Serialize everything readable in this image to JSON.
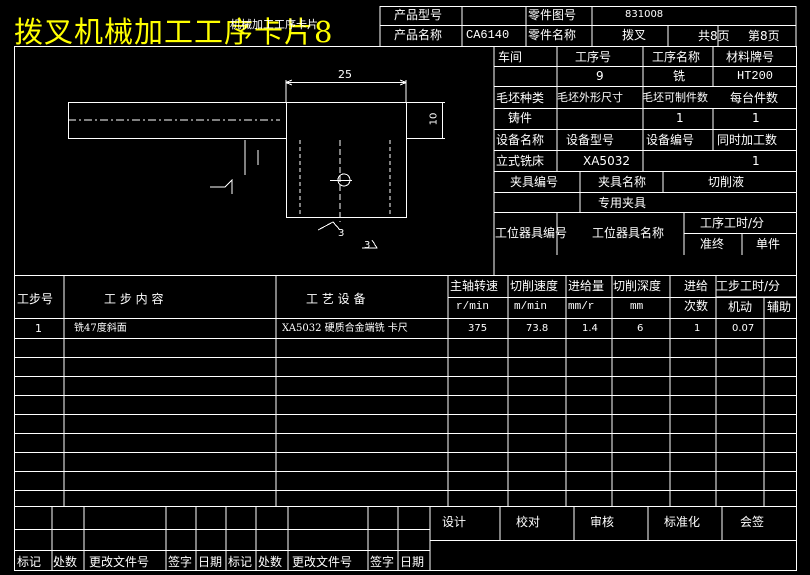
{
  "title": "拨叉机械加工工序卡片8",
  "header": {
    "card_name": "机械加工工序卡片",
    "product_model_label": "产品型号",
    "part_drawing_label": "零件图号",
    "part_drawing_no": "831008",
    "product_name_label": "产品名称",
    "product_name": "CA6140",
    "part_name_label": "零件名称",
    "part_name": "拨叉",
    "total_pages": "共8页",
    "page_no": "第8页"
  },
  "process_info": {
    "workshop_label": "车间",
    "op_no_label": "工序号",
    "op_name_label": "工序名称",
    "material_label": "材料牌号",
    "op_no": "9",
    "op_name": "铣",
    "material": "HT200",
    "blank_type_label": "毛坯种类",
    "blank_size_label": "毛坯外形尺寸",
    "blank_count_label": "毛坯可制件数",
    "per_unit_label": "每台件数",
    "blank_type": "铸件",
    "blank_count": "1",
    "per_unit": "1",
    "equip_name_label": "设备名称",
    "equip_model_label": "设备型号",
    "equip_no_label": "设备编号",
    "simul_label": "同时加工数",
    "equip_name": "立式铣床",
    "equip_model": "XA5032",
    "simul": "1",
    "fixture_no_label": "夹具编号",
    "fixture_name_label": "夹具名称",
    "coolant_label": "切削液",
    "fixture_name": "专用夹具",
    "station_tool_no_label": "工位器具编号",
    "station_tool_name_label": "工位器具名称",
    "op_time_label": "工序工时/分",
    "prep_label": "准终",
    "unit_label": "单件"
  },
  "table": {
    "step_no": "工步号",
    "step_content": "工  步  内  容",
    "equipment": "工  艺  设  备",
    "spindle": "主轴转速",
    "speed": "切削速度",
    "feed": "进给量",
    "depth": "切削深度",
    "passes_1": "进给",
    "passes_2": "次数",
    "step_time": "工步工时/分",
    "machine": "机动",
    "aux": "辅助",
    "unit_spindle": "r/min",
    "unit_speed": "m/min",
    "unit_feed": "mm/r",
    "unit_depth": "mm",
    "rows": [
      {
        "no": "1",
        "content": "铣47度斜面",
        "equip": "XA5032   硬质合金端铣  卡尺",
        "spindle": "375",
        "speed": "73.8",
        "feed": "1.4",
        "depth": "6",
        "passes": "1",
        "machine": "0.07",
        "aux": ""
      }
    ]
  },
  "footer": {
    "design": "设计",
    "proof": "校对",
    "review": "审核",
    "standard": "标准化",
    "sign": "会签",
    "mark": "标记",
    "count": "处数",
    "doc_no": "更改文件号",
    "signature": "签字",
    "date": "日期"
  },
  "drawing": {
    "dim_width": "25",
    "dim_height": "10",
    "rough_1": "3",
    "rough_2": "3"
  }
}
